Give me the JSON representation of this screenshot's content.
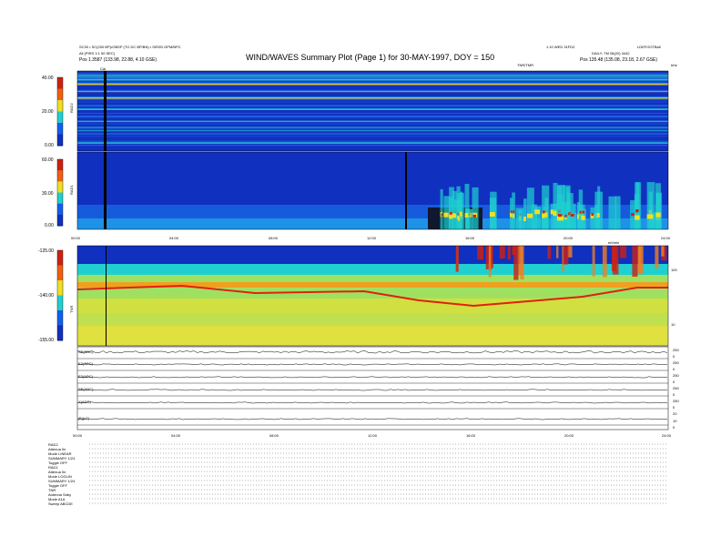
{
  "header": {
    "meta_left_1": "SC30 • SC(200 BP)•OBSP (TO DC BP/BN) • SIRZD DPM/BPC",
    "meta_left_2": "All (PIRS 3 1 50 SEC)",
    "pos_left": "Pos   1.3587 (133.98, 22.88, 4.10 GSE)",
    "title": "WIND/WAVES Summary Plot (Page 1) for 30-MAY-1997, DOY = 150",
    "meta_right_1": "1.10 WED 31FD2",
    "meta_right_2": "LDEFOOTBall",
    "meta_right_3": "DAILY: TM 08(20) 3442",
    "pos_right": "Pos   135.48 (135.08, 23.18, 2.67 GSE)",
    "tnr_mark": "TNR/TMR",
    "unit_right": "kHz"
  },
  "colors": {
    "background_low": "#1030c0",
    "mid": "#20d0d0",
    "high": "#f0e020",
    "peak": "#d02010"
  },
  "chart_data": [
    {
      "type": "heatmap",
      "name_label": "RAD2",
      "ylabel": "RAD2",
      "ylim": [
        0,
        40
      ],
      "yticks": [
        "40.00",
        "20.00",
        "0.00"
      ],
      "cal_label": "Cal"
    },
    {
      "type": "heatmap",
      "name_label": "RAD1",
      "ylabel": "RAD1",
      "ylim": [
        0,
        60
      ],
      "yticks": [
        "60.00",
        "30.00",
        "0.00"
      ],
      "xticks": [
        "00:00",
        "04:00",
        "08:00",
        "12:00",
        "16:00",
        "20:00",
        "24:00"
      ],
      "x_corner": "ert/min"
    },
    {
      "type": "heatmap",
      "name_label": "TNR",
      "ylabel": "TNR",
      "ylim": [
        -155,
        -125
      ],
      "yticks": [
        "-125.00",
        "-140.00",
        "-155.00"
      ],
      "right_ticks": [
        "100",
        "10"
      ]
    },
    {
      "type": "line",
      "rows": [
        {
          "label": "SE(ADC)",
          "right": [
            "250",
            "0"
          ]
        },
        {
          "label": "E2(ADC)",
          "right": [
            "250",
            "0"
          ]
        },
        {
          "label": "E3(ADC)",
          "right": [
            "250",
            "0"
          ]
        },
        {
          "label": "SE(ADC)",
          "right": [
            "250",
            "0"
          ]
        },
        {
          "label": "X(ADC)",
          "right": [
            "250",
            "0"
          ]
        },
        {
          "label": "|B|(nT)",
          "right": [
            "20",
            "10",
            "0"
          ]
        }
      ],
      "xticks": [
        "00:00",
        "04:00",
        "08:00",
        "12:00",
        "16:00",
        "20:00",
        "24:00"
      ]
    }
  ],
  "footer": {
    "lines": [
      "RAD2",
      "Attenua      0n",
      "Mode         LINEAR",
      "SUMMARY   1/24",
      "Toggle      OFF",
      "RAD1",
      "Attenua      0n",
      "Mode         LOGLIN",
      "SUMMARY   1/24",
      "Toggle      OFF",
      "TNR",
      "Antenna    Sdby",
      "Mode         A1A",
      "Sweep     ABCDE"
    ]
  }
}
